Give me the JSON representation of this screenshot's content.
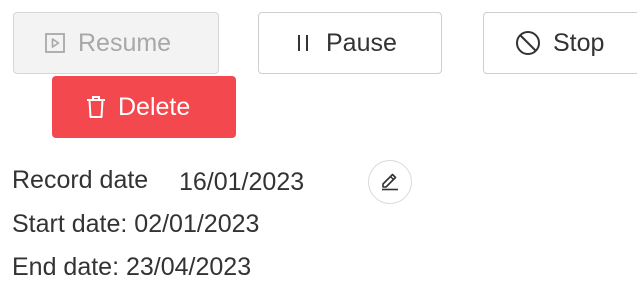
{
  "toolbar": {
    "resume": {
      "label": "Resume",
      "icon": "play-square-icon",
      "disabled": true
    },
    "pause": {
      "label": "Pause",
      "icon": "pause-icon"
    },
    "stop": {
      "label": "Stop",
      "icon": "stop-circle-icon"
    },
    "delete": {
      "label": "Delete",
      "icon": "trash-icon"
    }
  },
  "details": {
    "record_date_label": "Record date",
    "record_date_value": "16/01/2023",
    "edit_icon": "pencil-icon",
    "start_date": "Start date: 02/01/2023",
    "end_date": "End date: 23/04/2023"
  },
  "colors": {
    "danger": "#f4484f",
    "disabled_text": "#a8a8a8",
    "text": "#333333"
  }
}
